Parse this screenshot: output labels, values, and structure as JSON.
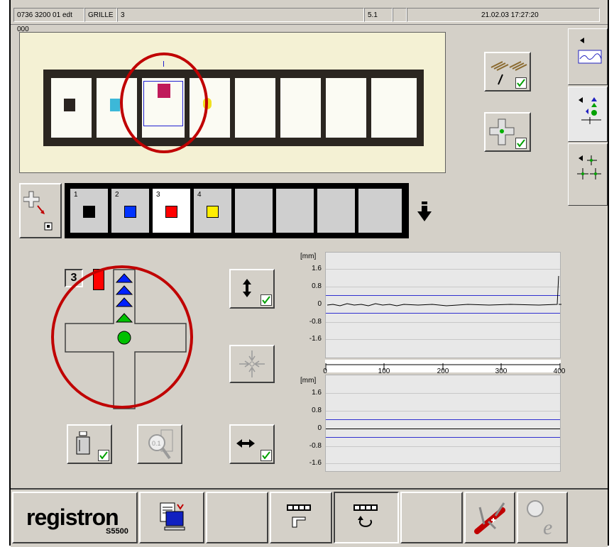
{
  "titlebar": {
    "doc_id": "0736 3200 01 edt 000",
    "mode": "GRILLE",
    "mode_number": "3",
    "version": "5.1",
    "datetime": "21.02.03 17:27:20"
  },
  "color_strip": {
    "slots": [
      {
        "number": "1",
        "color": "#000000"
      },
      {
        "number": "2",
        "color": "#0033ff"
      },
      {
        "number": "3",
        "color": "#ff0000"
      },
      {
        "number": "4",
        "color": "#ffee00"
      },
      {
        "number": "",
        "color": ""
      },
      {
        "number": "",
        "color": ""
      },
      {
        "number": "",
        "color": ""
      },
      {
        "number": "",
        "color": ""
      }
    ],
    "selected": 3
  },
  "cross_panel": {
    "selected_number": "3",
    "selected_color": "#ff0000"
  },
  "charts": {
    "top": {
      "unit": "[mm]",
      "y_ticks": [
        "1.6",
        "0.8",
        "0",
        "-0.8",
        "-1.6"
      ],
      "limit_upper": 0.4,
      "limit_lower": -0.4
    },
    "bottom": {
      "unit": "[mm]",
      "y_ticks": [
        "1.6",
        "0.8",
        "0",
        "-0.8",
        "-1.6"
      ],
      "limit_upper": 0.4,
      "limit_lower": -0.4
    },
    "x_ticks": [
      "0",
      "100",
      "200",
      "300",
      "400"
    ]
  },
  "bottombar": {
    "logo_text": "registron",
    "model": "S5500"
  },
  "colors": {
    "panel": "#d4d0c8",
    "annotation_circle": "#c00000",
    "check": "#00a000",
    "limit_line": "#3030d0"
  }
}
